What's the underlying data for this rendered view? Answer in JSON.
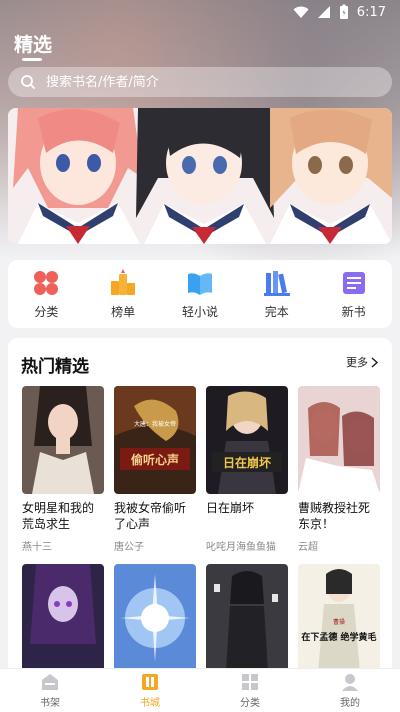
{
  "status_bar": {
    "time": "6:17"
  },
  "header": {
    "title": "精选"
  },
  "search": {
    "placeholder": "搜索书名/作者/简介"
  },
  "categories": [
    {
      "label": "分类",
      "icon": "category-icon",
      "color": "#f0605a"
    },
    {
      "label": "榜单",
      "icon": "ranking-icon",
      "color": "#f5a623"
    },
    {
      "label": "轻小说",
      "icon": "light-novel-icon",
      "color": "#3aa0f0"
    },
    {
      "label": "完本",
      "icon": "completed-icon",
      "color": "#4a7cf0"
    },
    {
      "label": "新书",
      "icon": "new-book-icon",
      "color": "#8a6cf0"
    }
  ],
  "hot": {
    "title": "热门精选",
    "more": "更多",
    "books": [
      {
        "title": "女明星和我的荒岛求生",
        "author": "燕十三"
      },
      {
        "title": "我被女帝偷听了心声",
        "author": "唐公子",
        "cover_text": "偷听心声",
        "cover_subtitle": "大唐：我被女帝"
      },
      {
        "title": "日在崩坏",
        "author": "叱咤月海鱼鱼猫",
        "cover_text": "日在崩坏"
      },
      {
        "title": "曹贼教授社死东京！",
        "author": "云超"
      },
      {
        "title": "",
        "author": ""
      },
      {
        "title": "",
        "author": ""
      },
      {
        "title": "",
        "author": ""
      },
      {
        "title": "",
        "author": "",
        "cover_text": "在下孟德 绝学黄毛",
        "cover_subtitle": "曹操"
      }
    ]
  },
  "tabs": [
    {
      "label": "书架",
      "icon": "bookshelf-icon",
      "active": false
    },
    {
      "label": "书城",
      "icon": "bookstore-icon",
      "active": true
    },
    {
      "label": "分类",
      "icon": "grid-icon",
      "active": false
    },
    {
      "label": "我的",
      "icon": "profile-icon",
      "active": false
    }
  ],
  "colors": {
    "accent": "#f5a623",
    "tab_inactive": "#666666"
  }
}
